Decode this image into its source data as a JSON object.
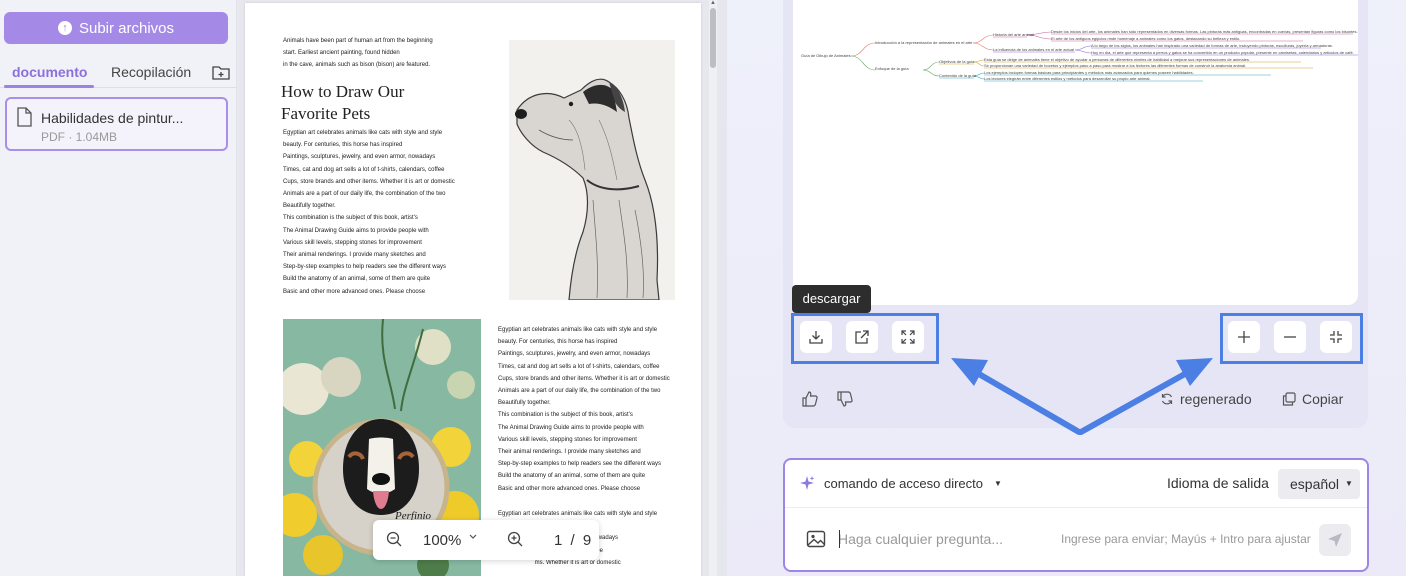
{
  "sidebar": {
    "upload_label": "Subir archivos",
    "tabs": [
      {
        "label": "documento",
        "active": true
      },
      {
        "label": "Recopilación",
        "active": false
      }
    ],
    "file": {
      "name": "Habilidades de pintur...",
      "meta": "PDF · 1.04MB"
    }
  },
  "document": {
    "intro": "Animals have been part of human art from the beginning\nstart. Earliest ancient painting, found hidden\nin the cave, animals such as bison (bison) are featured.",
    "heading": "How to Draw Our\nFavorite Pets",
    "body1": "Egyptian art celebrates animals like cats with style and style\nbeauty. For centuries, this horse has inspired\nPaintings, sculptures, jewelry, and even armor, nowadays\nTimes, cat and dog art sells a lot of t-shirts, calendars, coffee\nCups, store brands and other items. Whether it is art or domestic\nAnimals are a part of our daily life, the combination of the two\nBeautifully together.\nThis combination is the subject of this book, artist's\nThe Animal Drawing Guide aims to provide people with\nVarious skill levels, stepping stones for improvement\nTheir animal renderings. I provide many sketches and\nStep-by-step examples to help readers see the different ways\nBuild the anatomy of an animal, some of them are quite\nBasic and other more advanced ones. Please choose",
    "body2": "Egyptian art celebrates animals like cats with style and style\nbeauty. For centuries, this horse has inspired\nPaintings, sculptures, jewelry, and even armor, nowadays\nTimes, cat and dog art sells a lot of t-shirts, calendars, coffee\nCups, store brands and other items. Whether it is art or domestic\nAnimals are a part of our daily life, the combination of the two\nBeautifully together.\nThis combination is the subject of this book, artist's\nThe Animal Drawing Guide aims to provide people with\nVarious skill levels, stepping stones for improvement\nTheir animal renderings. I provide many sketches and\nStep-by-step examples to help readers see the different ways\nBuild the anatomy of an animal, some of them are quite\nBasic and other more advanced ones. Please choose",
    "body3": "Egyptian art celebrates animals like cats with style and style\n                      ax inspired\n                      nts, and even armor, nowadays\n                      s-shirts, calendars, coffee\n                      ms. Whether it is art or domestic",
    "photo_caption": "Perfinio",
    "zoom": "100%",
    "page": "1",
    "page_sep": "/",
    "total_pages": "9"
  },
  "mindmap": {
    "root": "Guía de Dibujo de Animales",
    "branches": [
      {
        "label": "Introducción a la representación de animales en el arte",
        "color": "#e07b6a"
      },
      {
        "label": "Enfoque de la guía",
        "color": "#6aa86b"
      }
    ],
    "nodes": [
      "Historia del arte animal",
      "La influencia de los animales en el arte actual",
      "Objetivos de la guía",
      "Contenido de la guía"
    ],
    "leaves": [
      "Desde los inicios del arte, los animales han sido representados en diversas formas. Las pinturas más antiguas, encontradas en cuevas, presentan figuras como los bisontes.",
      "El arte de los antiguos egipcios rinde homenaje a animales como los gatos, destacando su belleza y estilo.",
      "A lo largo de los siglos, los animales han inspirado una variedad de formas de arte, incluyendo pinturas, esculturas, joyería y armaduras.",
      "Hoy en día, el arte que representa a perros y gatos se ha convertido en un producto popular, presente en camisetas, calendarios y artículos de café.",
      "Esta guía se dirige de animales tiene el objetivo de ayudar a personas de diferentes niveles de habilidad a mejorar sus representaciones de animales.",
      "Se proporcionan una variedad de bocetos y ejemplos paso a paso para mostrar a los lectores las diferentes formas de construir la anatomía animal.",
      "Los ejemplos incluyen formas básicas para principiantes y métodos más avanzados para quienes poseen habilidades.",
      "Los lectores elegirán entre diferentes estilos y métodos para desarrollar su propio arte animal."
    ]
  },
  "toolbar": {
    "tooltip": "descargar",
    "download_icon": "download-icon",
    "share_icon": "share-icon",
    "fullscreen_icon": "fullscreen-icon",
    "zoom_in_icon": "plus-icon",
    "zoom_out_icon": "minus-icon",
    "fit_icon": "fit-screen-icon",
    "highlight_color": "#4b7fe3"
  },
  "feedback": {
    "regen_label": "regenerado",
    "copy_label": "Copiar"
  },
  "input": {
    "shortcut_label": "comando de acceso directo",
    "lang_label": "Idioma de salida",
    "lang_value": "español",
    "placeholder": "Haga cualquier pregunta...",
    "hint": "Ingrese para enviar; Mayús + Intro para ajustar"
  },
  "colors": {
    "accent": "#a48ae6",
    "arrow": "#4b7fe3"
  }
}
